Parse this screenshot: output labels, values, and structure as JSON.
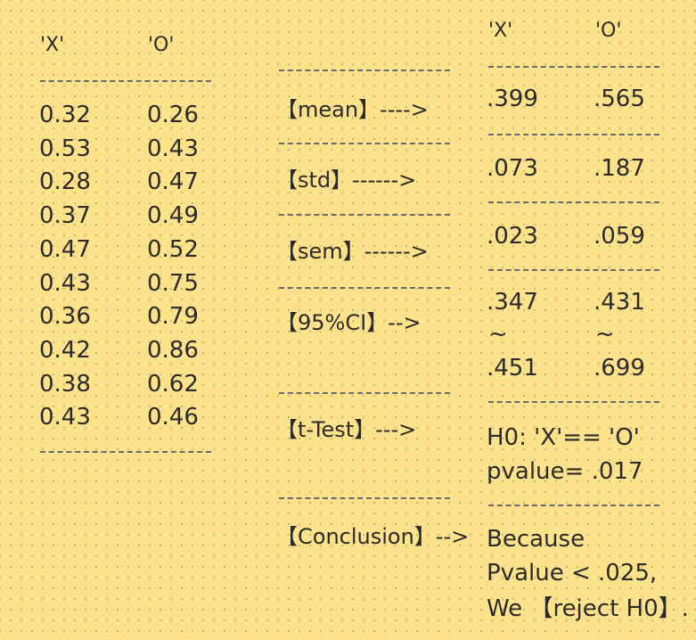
{
  "left_table": {
    "headers": [
      "'X'",
      "'O'"
    ],
    "rows": [
      [
        "0.32",
        "0.26"
      ],
      [
        "0.53",
        "0.43"
      ],
      [
        "0.28",
        "0.47"
      ],
      [
        "0.37",
        "0.49"
      ],
      [
        "0.47",
        "0.52"
      ],
      [
        "0.43",
        "0.75"
      ],
      [
        "0.36",
        "0.79"
      ],
      [
        "0.42",
        "0.86"
      ],
      [
        "0.38",
        "0.62"
      ],
      [
        "0.43",
        "0.46"
      ]
    ]
  },
  "stats": {
    "mean_label": "【mean】---->",
    "std_label": "【std】------>",
    "sem_label": "【sem】------>",
    "ci_label": "【95%CI】-->",
    "ttest_label": "【t-Test】--->",
    "conclusion_label": "【Conclusion】-->"
  },
  "results": {
    "headers": [
      "'X'",
      "'O'"
    ],
    "mean": [
      ".399",
      ".565"
    ],
    "std": [
      ".073",
      ".187"
    ],
    "sem": [
      ".023",
      ".059"
    ],
    "ci_low": [
      ".347",
      ".431"
    ],
    "ci_sep": [
      "~",
      "~"
    ],
    "ci_high": [
      ".451",
      ".699"
    ],
    "ttest_h0": "H0: 'X'== 'O'",
    "ttest_p": "pvalue= .017",
    "conclusion_lines": [
      "Because",
      "Pvalue < .025,",
      "We 【reject H0】."
    ]
  }
}
